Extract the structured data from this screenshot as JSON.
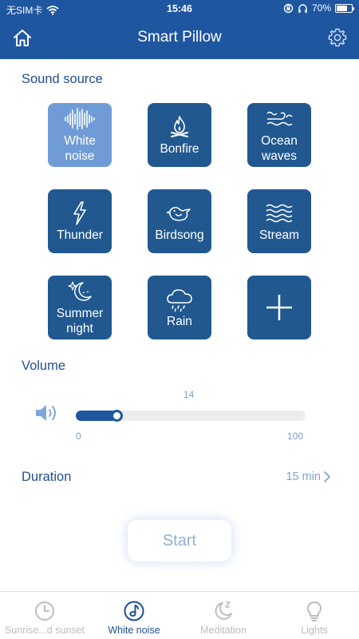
{
  "status_bar": {
    "carrier": "无SIM卡",
    "time": "15:46",
    "battery": "70%",
    "battery_level": 0.7
  },
  "header": {
    "title": "Smart Pillow",
    "left_icon": "home-icon",
    "right_icon": "gear-icon"
  },
  "sound_source": {
    "label": "Sound source",
    "tiles": [
      {
        "label": "White\nnoise",
        "icon": "waveform-icon",
        "selected": true
      },
      {
        "label": "Bonfire",
        "icon": "bonfire-icon",
        "selected": false
      },
      {
        "label": "Ocean\nwaves",
        "icon": "ocean-waves-icon",
        "selected": false
      },
      {
        "label": "Thunder",
        "icon": "lightning-icon",
        "selected": false
      },
      {
        "label": "Birdsong",
        "icon": "bird-icon",
        "selected": false
      },
      {
        "label": "Stream",
        "icon": "stream-waves-icon",
        "selected": false
      },
      {
        "label": "Summer\nnight",
        "icon": "moon-star-icon",
        "selected": false
      },
      {
        "label": "Rain",
        "icon": "rain-cloud-icon",
        "selected": false
      },
      {
        "label": "",
        "icon": "plus-icon",
        "selected": false
      }
    ]
  },
  "volume": {
    "label": "Volume",
    "value": "14",
    "min": "0",
    "max": "100",
    "level": 0.16
  },
  "duration": {
    "label": "Duration",
    "value": "15 min"
  },
  "start_label": "Start",
  "tabs": [
    {
      "label": "Sunrise...d sunset",
      "icon": "clock-icon",
      "active": false
    },
    {
      "label": "White noise",
      "icon": "music-disc-icon",
      "active": true
    },
    {
      "label": "Meditation",
      "icon": "sleep-moon-icon",
      "active": false
    },
    {
      "label": "Lights",
      "icon": "lightbulb-icon",
      "active": false
    }
  ],
  "colors": {
    "primary": "#1f56a0",
    "tile": "#215890",
    "tile_selected": "#6f9cd6",
    "muted": "#7da3cf",
    "inactive_tab": "#bdbdbd"
  }
}
